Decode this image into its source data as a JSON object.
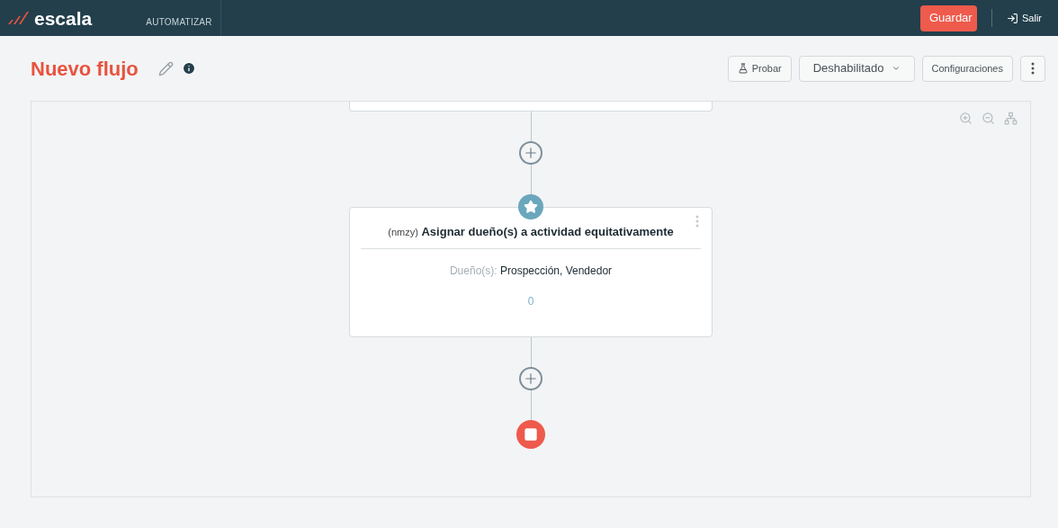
{
  "header": {
    "logo": "escala",
    "section": "AUTOMATIZAR",
    "save_button": "Guardar",
    "exit_link": "Salir"
  },
  "page": {
    "title": "Nuevo flujo"
  },
  "toolbar": {
    "test_button": "Probar",
    "status_dropdown": "Deshabilitado",
    "settings_button": "Configuraciones"
  },
  "canvas": {
    "nodes": [
      {
        "kind": "partial"
      },
      {
        "kind": "add"
      },
      {
        "kind": "action",
        "code": "(nmzy)",
        "title": "Asignar dueño(s) a actividad equitativamente",
        "field_label": "Dueño(s):",
        "field_value": "Prospección, Vendedor",
        "count": "0"
      },
      {
        "kind": "add"
      },
      {
        "kind": "end"
      }
    ]
  }
}
